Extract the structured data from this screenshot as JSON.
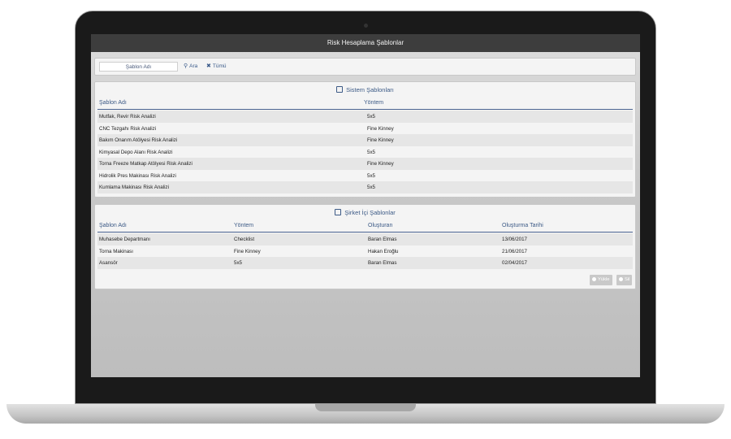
{
  "window": {
    "title": "Risk Hesaplama Şablonlar"
  },
  "search": {
    "placeholder": "Şablon Adı",
    "search_label": "Ara",
    "all_label": "Tümü"
  },
  "system_templates": {
    "title": "Sistem Şablonları",
    "columns": [
      "Şablon Adı",
      "Yöntem"
    ],
    "rows": [
      [
        "Mutfak, Revir Risk Analizi",
        "5x5"
      ],
      [
        "CNC Tezgahı Risk Analizi",
        "Fine Kinney"
      ],
      [
        "Bakım Onarım Atölyesi Risk Analizi",
        "Fine Kinney"
      ],
      [
        "Kimyasal Depo Alanı Risk Analizi",
        "5x5"
      ],
      [
        "Torna Freeze Matkap Atölyesi Risk Analizi",
        "Fine Kinney"
      ],
      [
        "Hidrolik Pres Makinası Risk Analizi",
        "5x5"
      ],
      [
        "Kumlama Makinası Risk Analizi",
        "5x5"
      ]
    ]
  },
  "company_templates": {
    "title": "Şirket İçi Şablonlar",
    "columns": [
      "Şablon Adı",
      "Yöntem",
      "Oluşturan",
      "Oluşturma Tarihi"
    ],
    "rows": [
      [
        "Muhasebe Departmanı",
        "Checklist",
        "Baran Elmas",
        "13/06/2017"
      ],
      [
        "Torna Makinası",
        "Fine Kinney",
        "Hakan Eroğlu",
        "21/06/2017"
      ],
      [
        "Asansör",
        "5x5",
        "Baran Elmas",
        "02/04/2017"
      ]
    ],
    "load_label": "Yükle",
    "delete_label": "Sil"
  },
  "colors": {
    "accent": "#3c5a86",
    "titlebar": "#3d3d3d"
  },
  "icons": {
    "search": "search-icon",
    "clear": "close-icon",
    "section": "edit-icon"
  }
}
